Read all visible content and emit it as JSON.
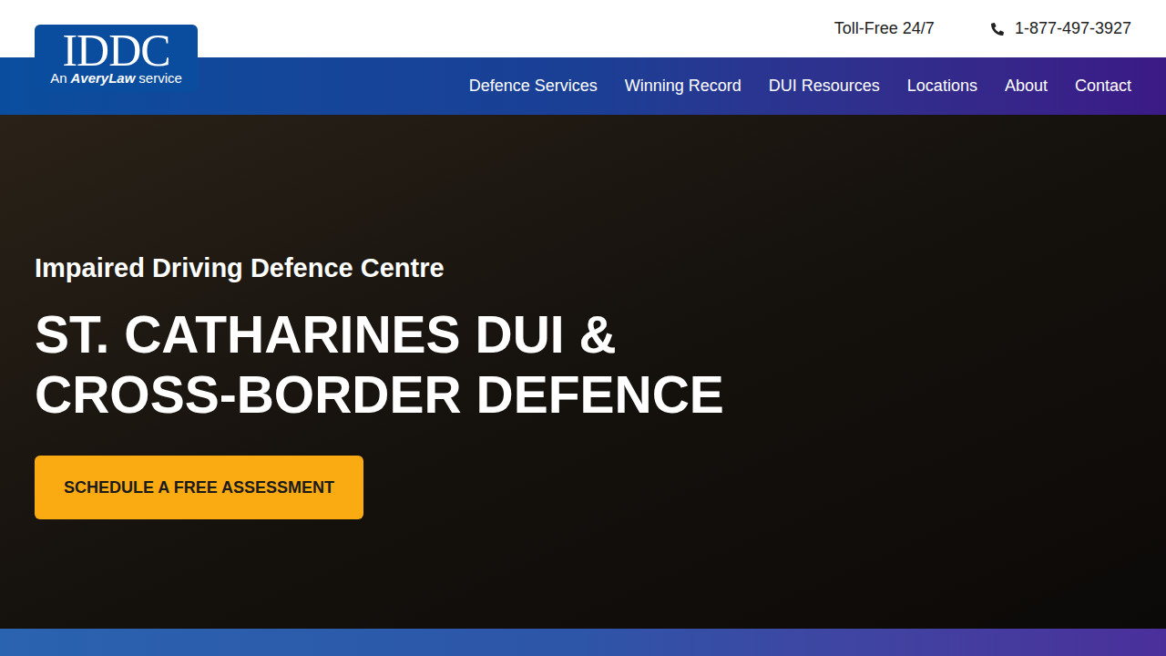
{
  "logo": {
    "title": "IDDC",
    "subtitle": [
      {
        "text": "An",
        "emphasis": false
      },
      {
        "text": "AveryLaw",
        "emphasis": true
      },
      {
        "text": "service",
        "emphasis": false
      }
    ]
  },
  "top_bar": {
    "toll_free": "Toll-Free 24/7",
    "phone": "1-877-497-3927"
  },
  "nav": [
    {
      "label": "Defence Services",
      "selected": false
    },
    {
      "label": "Winning Record",
      "selected": false
    },
    {
      "label": "DUI Resources",
      "selected": false
    },
    {
      "label": "Locations",
      "selected": false
    },
    {
      "label": "About",
      "selected": false
    },
    {
      "label": "Contact",
      "selected": false
    }
  ],
  "hero": {
    "eyebrow": "Impaired Driving Defence Centre",
    "heading": [
      "ST. CATHARINES DUI &",
      "CROSS-BORDER DEFENCE"
    ],
    "button": "SCHEDULE A FREE ASSESSMENT"
  }
}
